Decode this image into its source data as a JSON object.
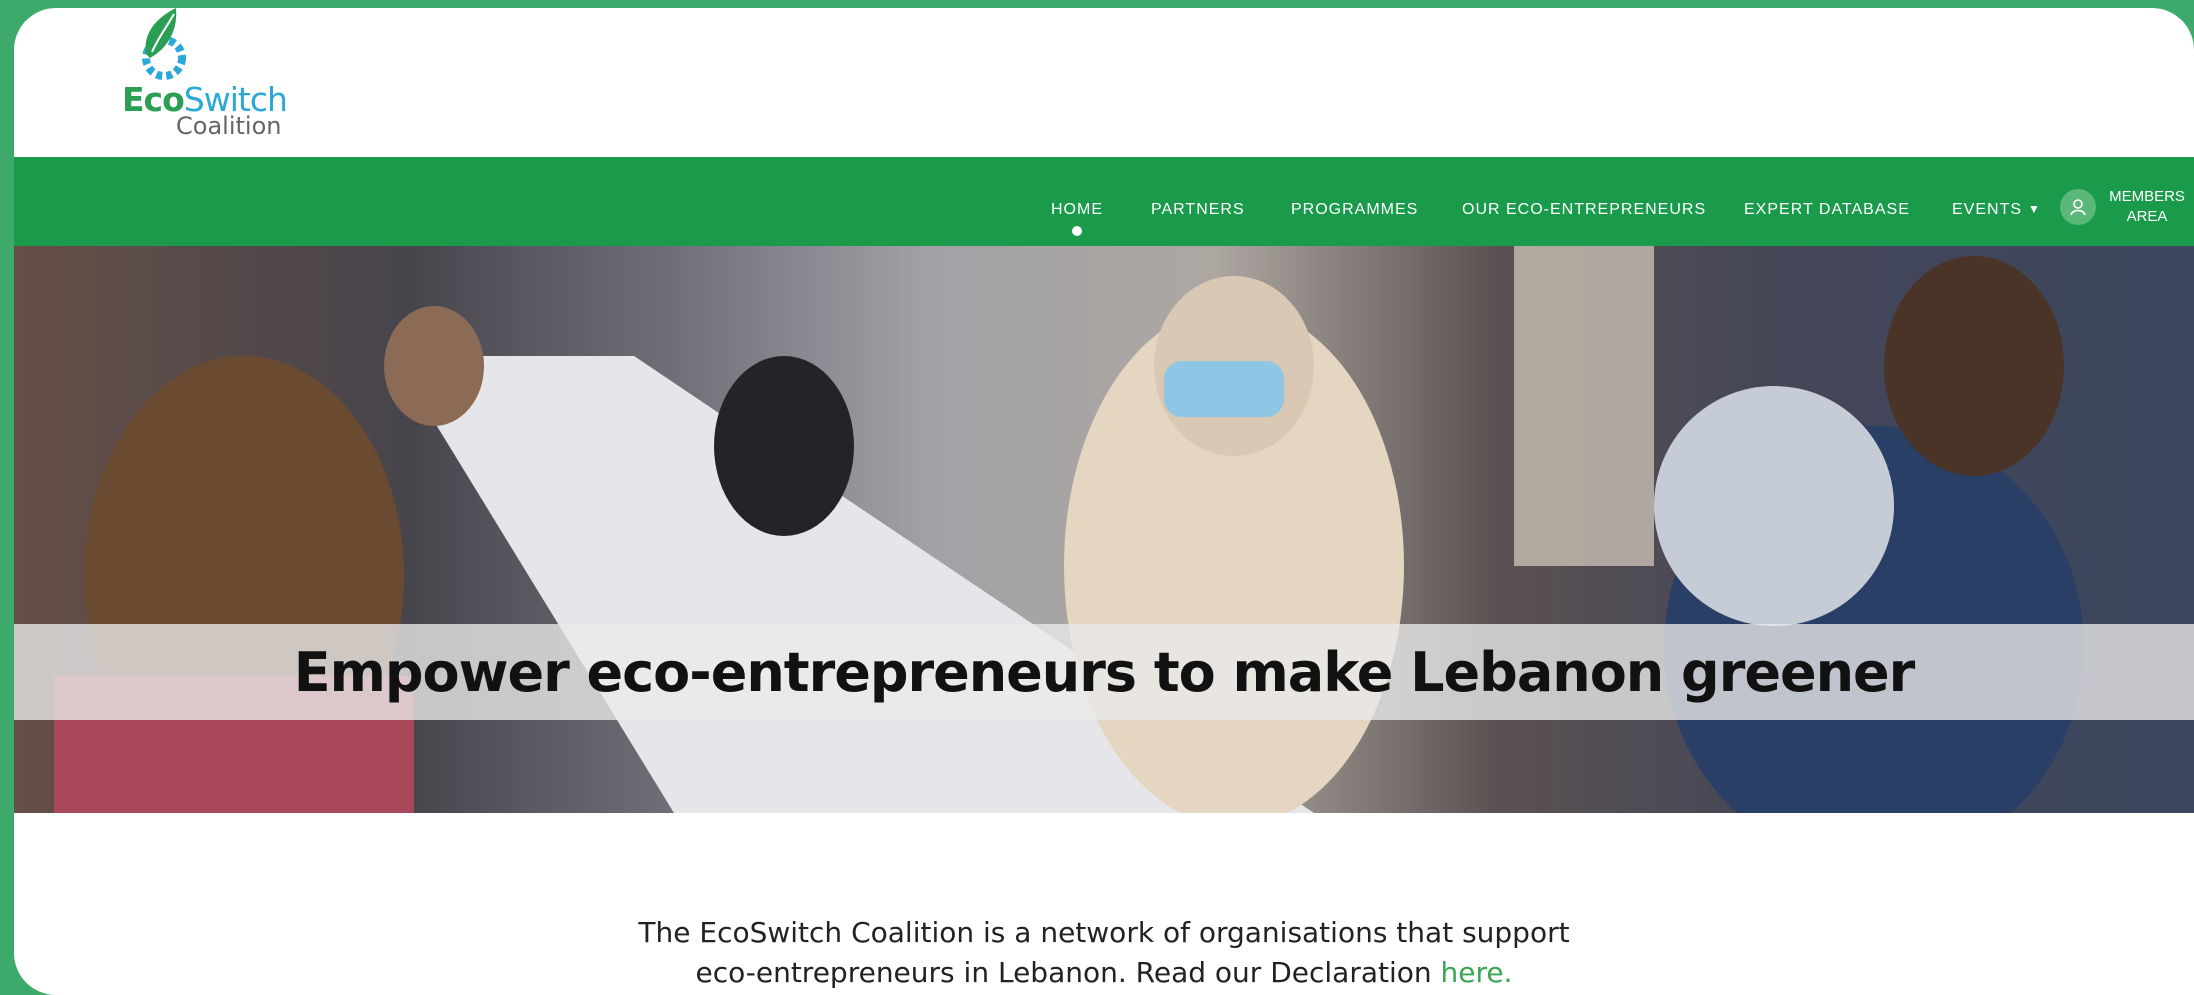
{
  "brand": {
    "logo_word1": "Eco",
    "logo_word2": "Switch",
    "logo_sub": "Coalition",
    "green": "#2a9e53",
    "blue": "#2aa8d8"
  },
  "nav": {
    "background": "#1a9a4b",
    "items": [
      {
        "label": "HOME",
        "active": true
      },
      {
        "label": "PARTNERS"
      },
      {
        "label": "PROGRAMMES"
      },
      {
        "label": "OUR ECO-ENTREPRENEURS"
      },
      {
        "label": "EXPERT DATABASE"
      },
      {
        "label": "EVENTS",
        "has_dropdown": true
      }
    ],
    "members_line1": "MEMBERS",
    "members_line2": "AREA",
    "members_icon": "user-icon"
  },
  "hero": {
    "title": "Empower eco-entrepreneurs to make Lebanon greener"
  },
  "intro": {
    "text": "The EcoSwitch Coalition is a network of organisations that support eco-entrepreneurs in Lebanon. Read our Declaration ",
    "link_text": "here."
  }
}
